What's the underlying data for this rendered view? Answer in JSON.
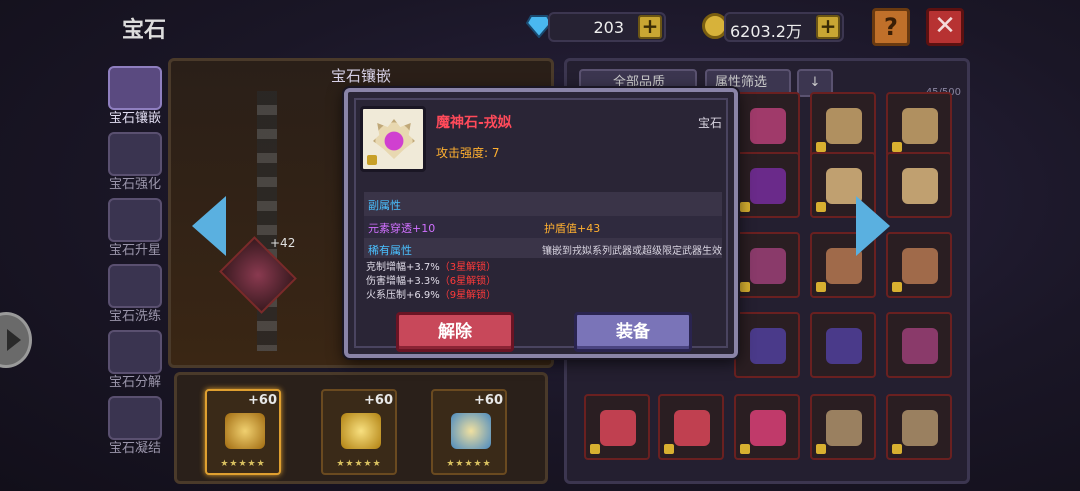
{
  "header": {
    "title": "宝石"
  },
  "currency": {
    "diamonds": "203",
    "gold": "6203.2万",
    "help_label": "?",
    "close_label": "✕"
  },
  "sidebar": {
    "items": [
      {
        "label": "宝石镶嵌",
        "active": true
      },
      {
        "label": "宝石强化",
        "active": false
      },
      {
        "label": "宝石升星",
        "active": false
      },
      {
        "label": "宝石洗练",
        "active": false
      },
      {
        "label": "宝石分解",
        "active": false
      },
      {
        "label": "宝石凝结",
        "active": false
      }
    ]
  },
  "inlay": {
    "title": "宝石镶嵌",
    "socket_bonus": "+42",
    "slots": [
      {
        "bonus": "+60",
        "stars": "★★★★★"
      },
      {
        "bonus": "+60",
        "stars": "★★★★★"
      },
      {
        "bonus": "+60",
        "stars": "★★★★★"
      }
    ]
  },
  "grid": {
    "filter_quality": "全部品质",
    "filter_attr": "属性筛选",
    "sort_icon": "↓",
    "count": "45/500"
  },
  "popup": {
    "name": "魔神石-戎姒",
    "type": "宝石",
    "attack": "攻击强度: 7",
    "sub_title": "副属性",
    "sub_vals": [
      "元素穿透+10",
      "护盾值+43"
    ],
    "rare_title": "稀有属性",
    "rare_note": "镶嵌到戎姒系列武器或超级限定武器生效",
    "rare_lines": [
      {
        "text": "克制增幅+3.7%",
        "lock": "（3星解锁）"
      },
      {
        "text": "伤害增幅+3.3%",
        "lock": "（6星解锁）"
      },
      {
        "text": "火系压制+6.9%",
        "lock": "（9星解锁）"
      }
    ],
    "remove_label": "解除",
    "equip_label": "装备"
  },
  "colors": {
    "accent_blue": "#5ab0e0",
    "rarity_red": "#ff4a5a",
    "gold": "#ffb030"
  }
}
